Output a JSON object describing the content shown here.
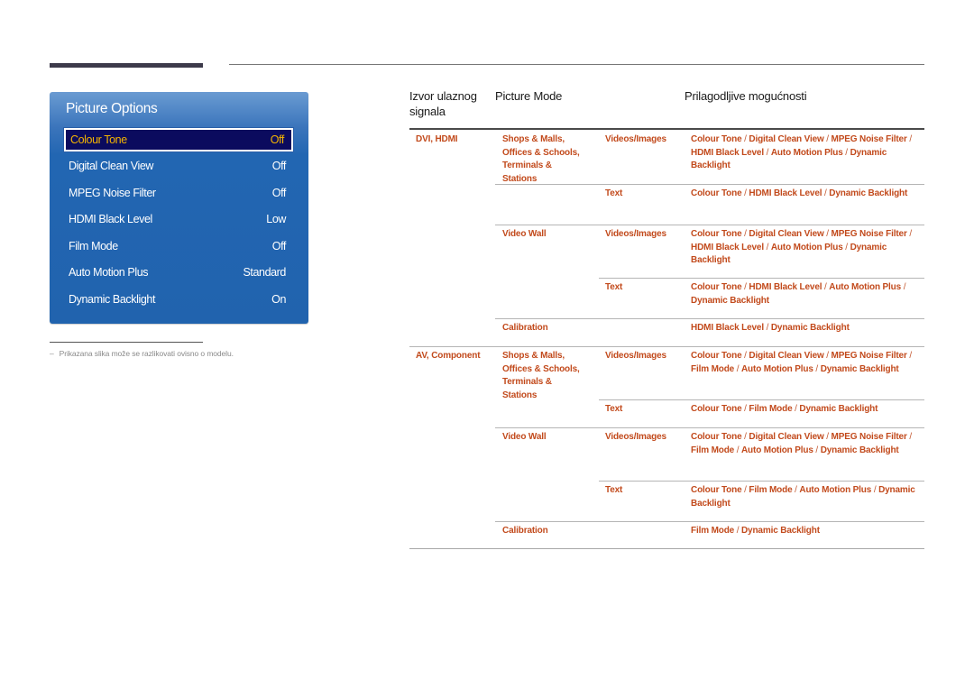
{
  "panel": {
    "title": "Picture Options",
    "items": [
      {
        "label": "Colour Tone",
        "value": "Off",
        "selected": true
      },
      {
        "label": "Digital Clean View",
        "value": "Off"
      },
      {
        "label": "MPEG Noise Filter",
        "value": "Off"
      },
      {
        "label": "HDMI Black Level",
        "value": "Low"
      },
      {
        "label": "Film Mode",
        "value": "Off"
      },
      {
        "label": "Auto Motion Plus",
        "value": "Standard"
      },
      {
        "label": "Dynamic Backlight",
        "value": "On"
      }
    ],
    "selected_color": "#f4b400",
    "bg_color": "#2163ae"
  },
  "footnote": {
    "dash": "–",
    "text": "Prikazana slika može se razlikovati ovisno o modelu."
  },
  "table": {
    "headers": {
      "source_line1": "Izvor ulaznog",
      "source_line2": "signala",
      "picture_mode": "Picture Mode",
      "options": "Prilagodljive mogućnosti"
    },
    "accent_color": "#c24a1c",
    "rows": {
      "dvi": {
        "source": "DVI, HDMI",
        "shops_l1": "Shops & Malls,",
        "shops_l2": "Offices & Schools,",
        "shops_l3": "Terminals &",
        "shops_l4": "Stations",
        "shops_vi_mode": "Videos/Images",
        "shops_vi_opts": [
          "Colour Tone",
          "Digital Clean View",
          "MPEG Noise Filter",
          "HDMI Black Level",
          "Auto Motion Plus",
          "Dynamic Backlight"
        ],
        "shops_text_mode": "Text",
        "shops_text_opts": [
          "Colour Tone",
          "HDMI Black Level",
          "Dynamic Backlight"
        ],
        "vw": "Video Wall",
        "vw_vi_mode": "Videos/Images",
        "vw_vi_opts": [
          "Colour Tone",
          "Digital Clean View",
          "MPEG Noise Filter",
          "HDMI Black Level",
          "Auto Motion Plus",
          "Dynamic Backlight"
        ],
        "vw_text_mode": "Text",
        "vw_text_opts": [
          "Colour Tone",
          "HDMI Black Level",
          "Auto Motion Plus",
          "Dynamic Backlight"
        ],
        "cal": "Calibration",
        "cal_opts": [
          "HDMI Black Level",
          "Dynamic Backlight"
        ]
      },
      "av": {
        "source": "AV, Component",
        "shops_l1": "Shops & Malls,",
        "shops_l2": "Offices & Schools,",
        "shops_l3": "Terminals &",
        "shops_l4": "Stations",
        "shops_vi_mode": "Videos/Images",
        "shops_vi_opts": [
          "Colour Tone",
          "Digital Clean View",
          "MPEG Noise Filter",
          "Film Mode",
          "Auto Motion Plus",
          "Dynamic Backlight"
        ],
        "shops_text_mode": "Text",
        "shops_text_opts": [
          "Colour Tone",
          "Film Mode",
          "Dynamic Backlight"
        ],
        "vw": "Video Wall",
        "vw_vi_mode": "Videos/Images",
        "vw_vi_opts": [
          "Colour Tone",
          "Digital Clean View",
          "MPEG Noise Filter",
          "Film Mode",
          "Auto Motion Plus",
          "Dynamic Backlight"
        ],
        "vw_text_mode": "Text",
        "vw_text_opts": [
          "Colour Tone",
          "Film Mode",
          "Auto Motion Plus",
          "Dynamic Backlight"
        ],
        "cal": "Calibration",
        "cal_opts": [
          "Film Mode",
          "Dynamic Backlight"
        ]
      }
    }
  }
}
